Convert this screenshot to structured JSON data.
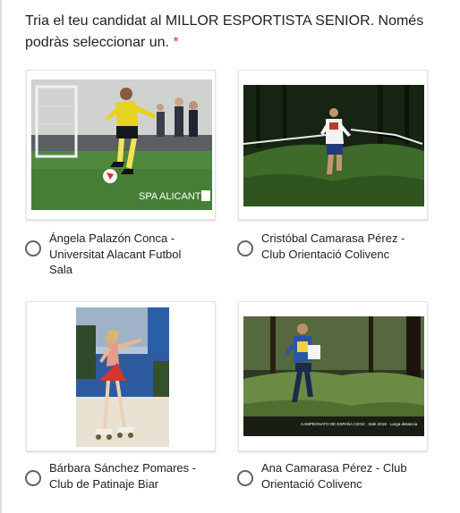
{
  "form": {
    "question": "Tria el teu candidat al MILLOR ESPORTISTA SENIOR. Només podràs seleccionar un.",
    "required_mark": "*"
  },
  "options": [
    {
      "label": "Ángela Palazón Conca - Universitat Alacant Futbol Sala",
      "selected": false,
      "photo_caption": "SPA ALICANTE"
    },
    {
      "label": "Cristóbal Camarasa Pérez - Club Orientació Colivenc",
      "selected": false
    },
    {
      "label": "Bárbara Sánchez Pomares - Club de Patinaje Biar",
      "selected": false
    },
    {
      "label": "Ana Camarasa Pérez - Club Orientació Colivenc",
      "selected": false,
      "photo_caption": "CAMPEONATO DE ESPAÑA CEO2 · Sele 2018 · Larga distancia"
    }
  ]
}
